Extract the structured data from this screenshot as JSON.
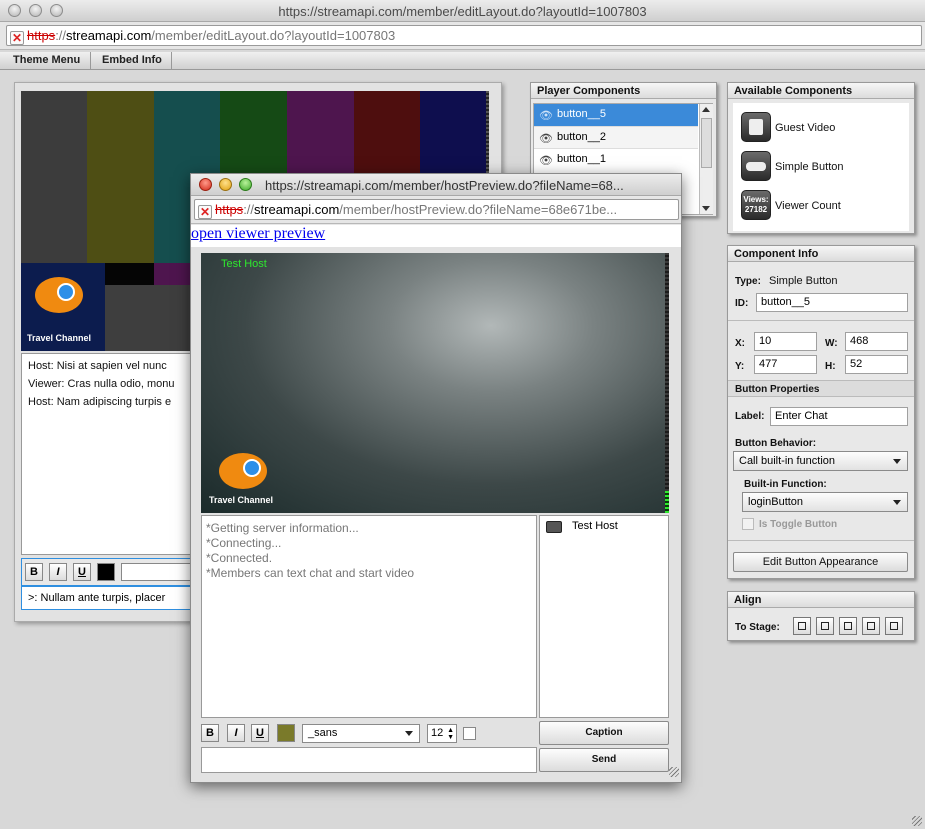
{
  "window": {
    "title": "https://streamapi.com/member/editLayout.do?layoutId=1007803",
    "url_scheme": "https",
    "url_sep": "://",
    "url_host": "streamapi.com",
    "url_path": "/member/editLayout.do?layoutId=1007803"
  },
  "menu": {
    "theme": "Theme Menu",
    "embed": "Embed Info"
  },
  "stage": {
    "logo_text": "Travel Channel",
    "chat_lines": [
      "Host: Nisi at sapien vel nunc",
      "Viewer: Cras nulla odio, monu",
      "Host: Nam adipiscing turpis e"
    ],
    "format": {
      "bold": "B",
      "italic": "I",
      "underline": "U"
    },
    "input_value": ">: Nullam ante turpis, placer"
  },
  "player_components": {
    "title": "Player Components",
    "items": [
      {
        "label": "button__5",
        "selected": true
      },
      {
        "label": "button__2",
        "selected": false
      },
      {
        "label": "button__1",
        "selected": false
      }
    ]
  },
  "available_components": {
    "title": "Available Components",
    "items": [
      {
        "label": "Guest Video",
        "icon": "guest-video-icon"
      },
      {
        "label": "Simple Button",
        "icon": "simple-button-icon"
      },
      {
        "label": "Viewer Count",
        "icon": "viewer-count-icon",
        "icon_line1": "Views:",
        "icon_line2": "27182"
      }
    ]
  },
  "component_info": {
    "title": "Component Info",
    "type_label": "Type:",
    "type_value": "Simple Button",
    "id_label": "ID:",
    "id_value": "button__5",
    "x_label": "X:",
    "x_value": "10",
    "w_label": "W:",
    "w_value": "468",
    "y_label": "Y:",
    "y_value": "477",
    "h_label": "H:",
    "h_value": "52",
    "props_title": "Button Properties",
    "label_label": "Label:",
    "label_value": "Enter Chat",
    "behavior_label": "Button Behavior:",
    "behavior_value": "Call built-in function",
    "builtin_label": "Built-in Function:",
    "builtin_value": "loginButton",
    "toggle_label": "Is Toggle Button",
    "edit_button": "Edit Button Appearance"
  },
  "align": {
    "title": "Align",
    "to_stage": "To Stage:"
  },
  "popup": {
    "title": "https://streamapi.com/member/hostPreview.do?fileName=68...",
    "url_scheme": "https",
    "url_sep": "://",
    "url_host": "streamapi.com",
    "url_path": "/member/hostPreview.do?fileName=68e671be...",
    "link": "open viewer preview",
    "video_label": "Test Host",
    "logo_text": "Travel Channel",
    "log_lines": [
      "*Getting server information...",
      "*Connecting...",
      "*Connected.",
      "*Members can text chat and start video"
    ],
    "user": "Test Host",
    "format": {
      "bold": "B",
      "italic": "I",
      "underline": "U"
    },
    "font_value": "_sans",
    "size_value": "12",
    "caption_button": "Caption",
    "send_button": "Send"
  },
  "colors": {
    "selection": "#3b8ad9",
    "video_label": "#2ee82e",
    "logo_orange": "#f08a10"
  }
}
